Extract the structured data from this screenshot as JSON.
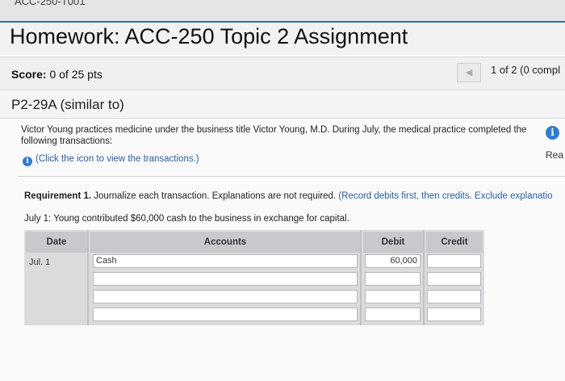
{
  "header": {
    "crumb": "ACC-250-T001",
    "title": "Homework: ACC-250 Topic 2 Assignment"
  },
  "score": {
    "label": "Score:",
    "value": "0 of 25 pts"
  },
  "nav": {
    "prev_icon": "left-arrow-icon",
    "progress": "1 of 2 (0 compl"
  },
  "problem": {
    "title": "P2-29A (similar to)",
    "description": "Victor Young practices medicine under the business title Victor Young, M.D. During July, the medical practice completed the following transactions:",
    "info_link": "(Click the icon to view the transactions.)",
    "side_read": "Rea"
  },
  "requirement": {
    "label": "Requirement 1.",
    "text": " Journalize each transaction. Explanations are not required.",
    "hint": " (Record debits first, then credits. Exclude explanatio",
    "transaction": "July 1: Young contributed $60,000 cash to the business in exchange for capital."
  },
  "journal": {
    "headers": {
      "date": "Date",
      "accounts": "Accounts",
      "debit": "Debit",
      "credit": "Credit"
    },
    "rows": [
      {
        "date": "Jul. 1",
        "account": "Cash",
        "debit": "60,000",
        "credit": ""
      },
      {
        "date": "",
        "account": "",
        "debit": "",
        "credit": ""
      },
      {
        "date": "",
        "account": "",
        "debit": "",
        "credit": ""
      },
      {
        "date": "",
        "account": "",
        "debit": "",
        "credit": ""
      }
    ]
  }
}
